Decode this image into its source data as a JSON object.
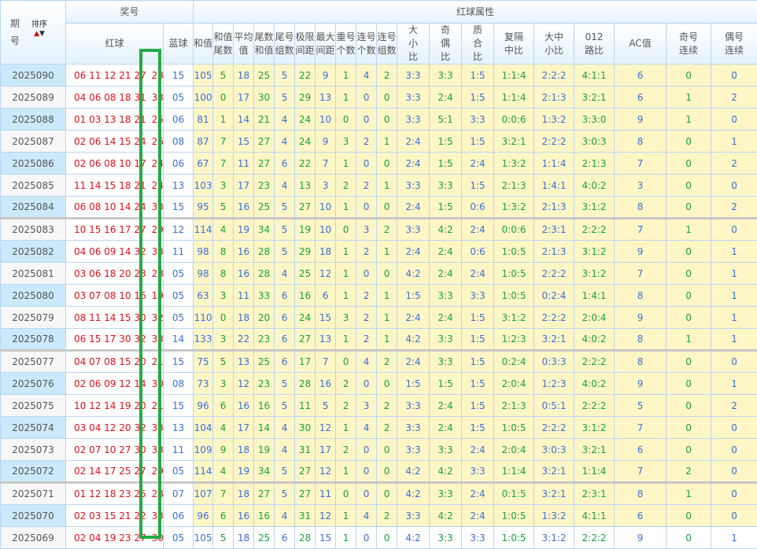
{
  "header": {
    "qihao": "期号",
    "sort": "排序",
    "sort_up": "▲",
    "sort_down": "▼",
    "jianghao": "奖号",
    "hongqiu": "红球",
    "lanqiu": "蓝球",
    "attr_group": "红球属性",
    "columns": [
      "和值",
      "和值尾数",
      "平均值",
      "尾数和值",
      "尾号组数",
      "极限间距",
      "最大间距",
      "重号个数",
      "连号个数",
      "连号组数",
      "大小比",
      "奇偶比",
      "质合比",
      "复隔中比",
      "大中小比",
      "012路比",
      "AC值",
      "奇号连续",
      "偶号连续"
    ]
  },
  "colors": {
    "red": "#e0101a",
    "blue": "#3a6fd8",
    "green": "#17a33a",
    "highlight_box": "#22aa44"
  },
  "rows": [
    [
      "2025090",
      "06 11 12 21 27",
      "28",
      "15",
      [
        "105",
        "5",
        "18",
        "25",
        "5",
        "22",
        "9",
        "1",
        "4",
        "2",
        "3:3",
        "3:3",
        "1:5",
        "1:1:4",
        "2:2:2",
        "4:1:1",
        "6",
        "0",
        "0"
      ]
    ],
    [
      "2025089",
      "04 06 08 18 31",
      "33",
      "05",
      [
        "100",
        "0",
        "17",
        "30",
        "5",
        "29",
        "13",
        "1",
        "0",
        "0",
        "3:3",
        "2:4",
        "1:5",
        "1:1:4",
        "2:1:3",
        "3:2:1",
        "6",
        "1",
        "2"
      ]
    ],
    [
      "2025088",
      "01 03 13 18 21",
      "25",
      "06",
      [
        "81",
        "1",
        "14",
        "21",
        "4",
        "24",
        "10",
        "0",
        "0",
        "0",
        "3:3",
        "5:1",
        "3:3",
        "0:0:6",
        "1:3:2",
        "3:3:0",
        "9",
        "1",
        "0"
      ]
    ],
    [
      "2025087",
      "02 06 14 15 24",
      "26",
      "08",
      [
        "87",
        "7",
        "15",
        "27",
        "4",
        "24",
        "9",
        "3",
        "2",
        "1",
        "2:4",
        "1:5",
        "1:5",
        "3:2:1",
        "2:2:2",
        "3:0:3",
        "8",
        "0",
        "1"
      ]
    ],
    [
      "2025086",
      "02 06 08 10 17",
      "24",
      "06",
      [
        "67",
        "7",
        "11",
        "27",
        "6",
        "22",
        "7",
        "1",
        "0",
        "0",
        "2:4",
        "1:5",
        "2:4",
        "1:3:2",
        "1:1:4",
        "2:1:3",
        "7",
        "0",
        "2"
      ]
    ],
    [
      "2025085",
      "11 14 15 18 21",
      "24",
      "13",
      [
        "103",
        "3",
        "17",
        "23",
        "4",
        "13",
        "3",
        "2",
        "2",
        "1",
        "3:3",
        "3:3",
        "1:5",
        "2:1:3",
        "1:4:1",
        "4:0:2",
        "3",
        "0",
        "0"
      ]
    ],
    [
      "2025084",
      "06 08 10 14 24",
      "33",
      "15",
      [
        "95",
        "5",
        "16",
        "25",
        "5",
        "27",
        "10",
        "1",
        "0",
        "0",
        "2:4",
        "1:5",
        "0:6",
        "1:3:2",
        "2:1:3",
        "3:1:2",
        "8",
        "0",
        "2"
      ]
    ],
    [
      "2025083",
      "10 15 16 17 27",
      "29",
      "12",
      [
        "114",
        "4",
        "19",
        "34",
        "5",
        "19",
        "10",
        "0",
        "3",
        "2",
        "3:3",
        "4:2",
        "2:4",
        "0:0:6",
        "2:3:1",
        "2:2:2",
        "7",
        "1",
        "0"
      ]
    ],
    [
      "2025082",
      "04 06 09 14 32",
      "33",
      "11",
      [
        "98",
        "8",
        "16",
        "28",
        "5",
        "29",
        "18",
        "1",
        "2",
        "1",
        "2:4",
        "2:4",
        "0:6",
        "1:0:5",
        "2:1:3",
        "3:1:2",
        "9",
        "0",
        "1"
      ]
    ],
    [
      "2025081",
      "03 06 18 20 23",
      "28",
      "05",
      [
        "98",
        "8",
        "16",
        "28",
        "4",
        "25",
        "12",
        "1",
        "0",
        "0",
        "4:2",
        "2:4",
        "2:4",
        "1:0:5",
        "2:2:2",
        "3:1:2",
        "7",
        "0",
        "1"
      ]
    ],
    [
      "2025080",
      "03 07 08 10 16",
      "19",
      "05",
      [
        "63",
        "3",
        "11",
        "33",
        "6",
        "16",
        "6",
        "1",
        "2",
        "1",
        "1:5",
        "3:3",
        "3:3",
        "1:0:5",
        "0:2:4",
        "1:4:1",
        "8",
        "0",
        "1"
      ]
    ],
    [
      "2025079",
      "08 11 14 15 30",
      "32",
      "05",
      [
        "110",
        "0",
        "18",
        "20",
        "6",
        "24",
        "15",
        "3",
        "2",
        "1",
        "2:4",
        "2:4",
        "1:5",
        "3:1:2",
        "2:2:2",
        "2:0:4",
        "9",
        "0",
        "1"
      ]
    ],
    [
      "2025078",
      "06 15 17 30 32",
      "33",
      "14",
      [
        "133",
        "3",
        "22",
        "23",
        "6",
        "27",
        "13",
        "1",
        "2",
        "1",
        "4:2",
        "3:3",
        "1:5",
        "1:2:3",
        "3:2:1",
        "4:0:2",
        "8",
        "1",
        "1"
      ]
    ],
    [
      "2025077",
      "04 07 08 15 20",
      "21",
      "15",
      [
        "75",
        "5",
        "13",
        "25",
        "6",
        "17",
        "7",
        "0",
        "4",
        "2",
        "2:4",
        "3:3",
        "1:5",
        "0:2:4",
        "0:3:3",
        "2:2:2",
        "8",
        "0",
        "0"
      ]
    ],
    [
      "2025076",
      "02 06 09 12 14",
      "30",
      "08",
      [
        "73",
        "3",
        "12",
        "23",
        "5",
        "28",
        "16",
        "2",
        "0",
        "0",
        "1:5",
        "1:5",
        "1:5",
        "2:0:4",
        "1:2:3",
        "4:0:2",
        "9",
        "0",
        "1"
      ]
    ],
    [
      "2025075",
      "10 12 14 19 20",
      "21",
      "15",
      [
        "96",
        "6",
        "16",
        "16",
        "5",
        "11",
        "5",
        "2",
        "3",
        "2",
        "3:3",
        "2:4",
        "1:5",
        "2:1:3",
        "0:5:1",
        "2:2:2",
        "5",
        "0",
        "2"
      ]
    ],
    [
      "2025074",
      "03 04 12 20 32",
      "33",
      "13",
      [
        "104",
        "4",
        "17",
        "14",
        "4",
        "30",
        "12",
        "1",
        "4",
        "2",
        "3:3",
        "2:4",
        "1:5",
        "1:0:5",
        "2:2:2",
        "3:1:2",
        "7",
        "0",
        "0"
      ]
    ],
    [
      "2025073",
      "02 07 10 27 30",
      "33",
      "11",
      [
        "109",
        "9",
        "18",
        "19",
        "4",
        "31",
        "17",
        "2",
        "0",
        "0",
        "3:3",
        "3:3",
        "2:4",
        "2:0:4",
        "3:0:3",
        "3:2:1",
        "6",
        "0",
        "0"
      ]
    ],
    [
      "2025072",
      "02 14 17 25 27",
      "29",
      "05",
      [
        "114",
        "4",
        "19",
        "34",
        "5",
        "27",
        "12",
        "1",
        "0",
        "0",
        "4:2",
        "4:2",
        "3:3",
        "1:1:4",
        "3:2:1",
        "1:1:4",
        "7",
        "2",
        "0"
      ]
    ],
    [
      "2025071",
      "01 12 18 23 25",
      "28",
      "07",
      [
        "107",
        "7",
        "18",
        "27",
        "5",
        "27",
        "11",
        "0",
        "0",
        "0",
        "4:2",
        "3:3",
        "2:4",
        "0:1:5",
        "3:2:1",
        "2:3:1",
        "8",
        "1",
        "0"
      ]
    ],
    [
      "2025070",
      "02 03 15 21 22",
      "33",
      "06",
      [
        "96",
        "6",
        "16",
        "16",
        "4",
        "31",
        "12",
        "1",
        "4",
        "2",
        "3:3",
        "4:2",
        "2:4",
        "1:0:5",
        "1:3:2",
        "4:1:1",
        "6",
        "0",
        "0"
      ]
    ],
    [
      "2025069",
      "02 04 19 23 27",
      "30",
      "05",
      [
        "105",
        "5",
        "18",
        "25",
        "6",
        "28",
        "15",
        "1",
        "0",
        "0",
        "4:2",
        "3:3",
        "3:3",
        "1:0:5",
        "3:1:2",
        "2:2:2",
        "9",
        "0",
        "1"
      ]
    ]
  ]
}
